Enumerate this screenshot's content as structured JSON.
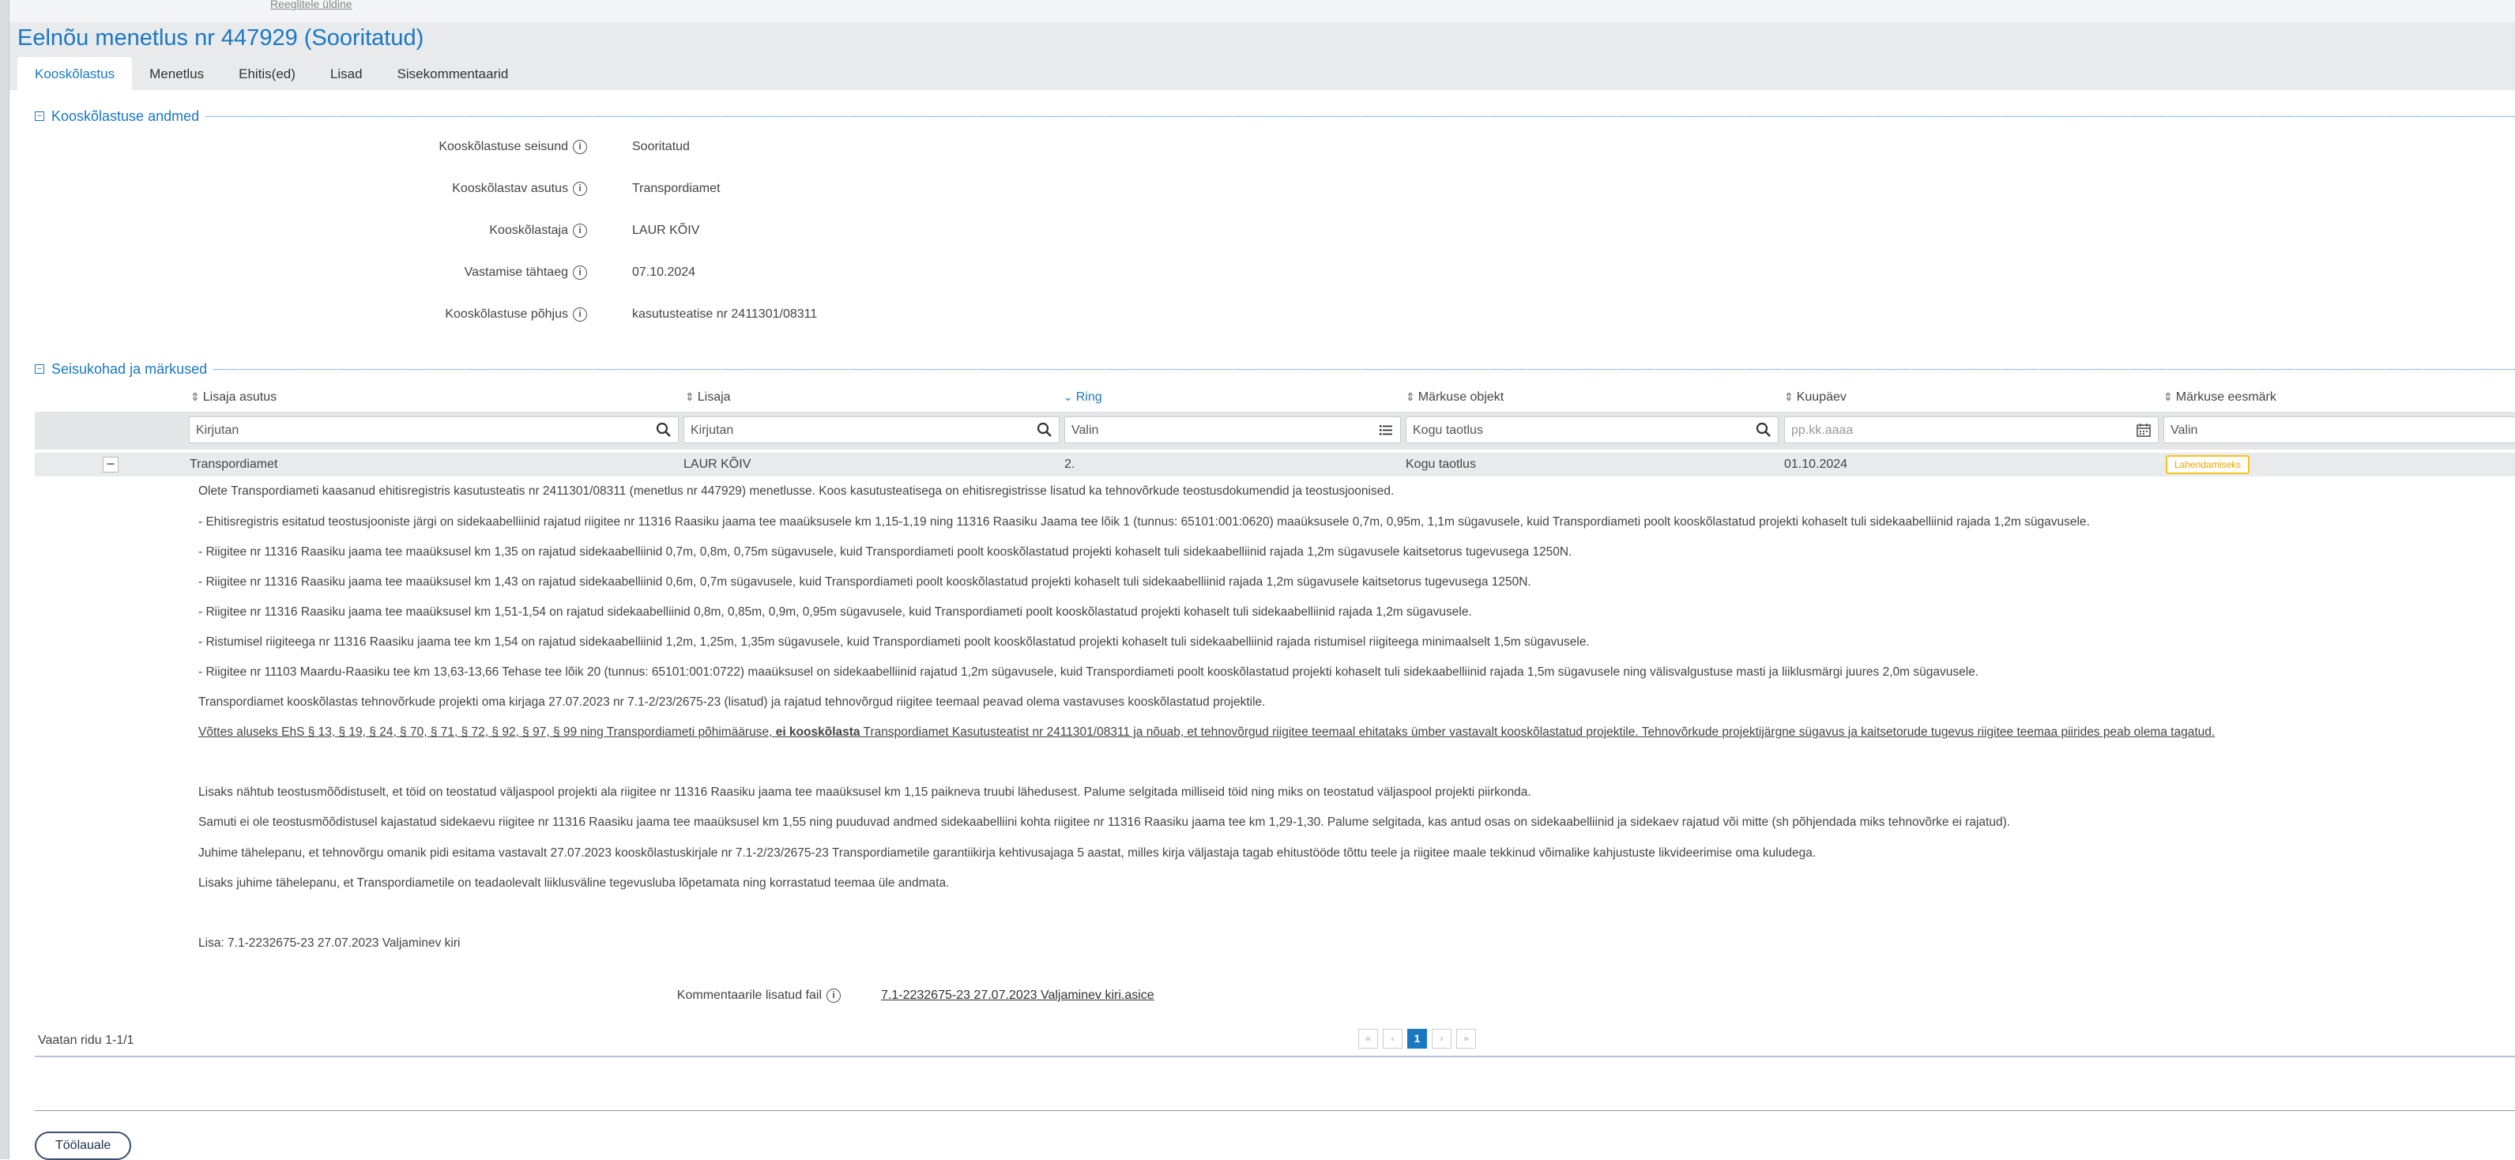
{
  "top_ghost_link": "Reeglitele üldine",
  "page_title": "Eelnõu menetlus nr 447929 (Sooritatud)",
  "tabs": [
    {
      "label": "Kooskõlastus",
      "active": true
    },
    {
      "label": "Menetlus"
    },
    {
      "label": "Ehitis(ed)"
    },
    {
      "label": "Lisad"
    },
    {
      "label": "Sisekommentaarid"
    }
  ],
  "section1": {
    "title": "Kooskõlastuse andmed",
    "toggle": "−",
    "fields": [
      {
        "label": "Kooskõlastuse seisund",
        "value": "Sooritatud"
      },
      {
        "label": "Kooskõlastav asutus",
        "value": "Transpordiamet"
      },
      {
        "label": "Kooskõlastaja",
        "value": "LAUR KÕIV"
      },
      {
        "label": "Vastamise tähtaeg",
        "value": "07.10.2024"
      },
      {
        "label": "Kooskõlastuse põhjus",
        "value": "kasutusteatise nr 2411301/08311"
      }
    ]
  },
  "section2": {
    "title": "Seisukohad ja märkused",
    "toggle": "−"
  },
  "table": {
    "columns": [
      {
        "label": "Lisaja asutus",
        "sort": "⇕"
      },
      {
        "label": "Lisaja",
        "sort": "⇕"
      },
      {
        "label": "Ring",
        "sort": "⌄",
        "sorted": true
      },
      {
        "label": "Märkuse objekt",
        "sort": "⇕"
      },
      {
        "label": "Kuupäev",
        "sort": "⇕"
      },
      {
        "label": "Märkuse eesmärk",
        "sort": "⇕"
      }
    ],
    "filters": [
      {
        "value": "Kirjutan"
      },
      {
        "value": "Kirjutan"
      },
      {
        "value": "Valin"
      },
      {
        "value": "Kogu taotlus"
      },
      {
        "placeholder": "pp.kk.aaaa"
      },
      {
        "value": "Valin"
      }
    ],
    "row": {
      "collapse": "−",
      "asutus": "Transpordiamet",
      "lisaja": "LAUR KÕIV",
      "ring": "2.",
      "objekt": "Kogu taotlus",
      "kuupaev": "01.10.2024",
      "eesmark": "Lahendamiseks"
    },
    "comment_paragraphs": [
      "Olete Transpordiameti kaasanud ehitisregistris kasutusteatis nr 2411301/08311 (menetlus nr 447929) menetlusse. Koos kasutusteatisega on ehitisregistrisse lisatud ka tehnovõrkude teostusdokumendid ja teostusjoonised.",
      "- Ehitisregistris esitatud teostusjooniste järgi on sidekaabelliinid rajatud riigitee nr 11316 Raasiku jaama tee maaüksusele km 1,15-1,19 ning 11316 Raasiku Jaama tee lõik 1 (tunnus: 65101:001:0620) maaüksusele 0,7m, 0,95m, 1,1m sügavusele, kuid Transpordiameti poolt kooskõlastatud projekti kohaselt tuli sidekaabelliinid rajada 1,2m sügavusele.",
      "- Riigitee nr 11316 Raasiku jaama tee maaüksusel km 1,35 on rajatud sidekaabelliinid 0,7m, 0,8m, 0,75m sügavusele, kuid Transpordiameti poolt kooskõlastatud projekti kohaselt tuli sidekaabelliinid rajada 1,2m sügavusele kaitsetorus tugevusega 1250N.",
      "- Riigitee nr 11316 Raasiku jaama tee maaüksusel km 1,43 on rajatud sidekaabelliinid 0,6m, 0,7m sügavusele, kuid Transpordiameti poolt kooskõlastatud projekti kohaselt tuli sidekaabelliinid rajada 1,2m sügavusele kaitsetorus tugevusega 1250N.",
      "- Riigitee nr 11316 Raasiku jaama tee maaüksusel km 1,51-1,54 on rajatud sidekaabelliinid 0,8m, 0,85m, 0,9m, 0,95m sügavusele, kuid Transpordiameti poolt kooskõlastatud projekti kohaselt tuli sidekaabelliinid rajada 1,2m sügavusele.",
      "-  Ristumisel riigiteega nr 11316 Raasiku jaama tee km 1,54 on rajatud sidekaabelliinid 1,2m, 1,25m, 1,35m sügavusele, kuid Transpordiameti poolt kooskõlastatud projekti kohaselt tuli sidekaabelliinid rajada ristumisel riigiteega minimaalselt 1,5m sügavusele.",
      "-  Riigitee nr 11103 Maardu-Raasiku tee km 13,63-13,66 Tehase tee lõik 20 (tunnus: 65101:001:0722) maaüksusel on sidekaabelliinid rajatud 1,2m sügavusele, kuid Transpordiameti poolt kooskõlastatud projekti kohaselt tuli sidekaabelliinid rajada 1,5m sügavusele ning välisvalgustuse masti ja liiklusmärgi juures 2,0m sügavusele.",
      "Transpordiamet kooskõlastas tehnovõrkude projekti oma kirjaga 27.07.2023 nr 7.1-2/23/2675-23 (lisatud) ja rajatud tehnovõrgud riigitee teemaal peavad olema vastavuses kooskõlastatud projektile."
    ],
    "underlined": {
      "before": "Võttes aluseks EhS § 13, § 19, § 24, § 70, § 71, § 72, § 92, § 97, § 99 ning Transpordiameti põhimääruse, ",
      "bold": "ei kooskõlasta",
      "after": " Transpordiamet Kasutusteatist nr 2411301/08311 ja nõuab, et tehnovõrgud riigitee teemaal ehitataks ümber vastavalt kooskõlastatud projektile. Tehnovõrkude projektijärgne sügavus ja kaitsetorude tugevus riigitee teemaa piirides peab olema tagatud."
    },
    "comment_paragraphs_2": [
      "Lisaks nähtub teostusmõõdistuselt, et töid on teostatud väljaspool projekti ala riigitee nr 11316 Raasiku jaama tee maaüksusel km 1,15 paikneva truubi lähedusest. Palume selgitada milliseid töid ning miks on teostatud väljaspool projekti piirkonda.",
      "Samuti ei ole teostusmõõdistusel kajastatud sidekaevu riigitee nr 11316 Raasiku jaama tee maaüksusel km 1,55 ning puuduvad andmed sidekaabelliini kohta riigitee nr 11316 Raasiku jaama tee km 1,29-1,30. Palume selgitada, kas antud osas on sidekaabelliinid ja sidekaev rajatud või mitte (sh põhjendada miks tehnovõrke ei rajatud).",
      "Juhime tähelepanu, et tehnovõrgu omanik pidi esitama vastavalt 27.07.2023 kooskõlastuskirjale nr 7.1-2/23/2675-23 Transpordiametile garantiikirja kehtivusajaga 5 aastat, milles kirja väljastaja tagab ehitustööde tõttu teele ja riigitee maale tekkinud võimalike kahjustuste likvideerimise oma kuludega.",
      "Lisaks juhime tähelepanu, et Transpordiametile on teadaolevalt liiklusväline tegevusluba lõpetamata ning korrastatud teemaa üle andmata."
    ],
    "attachment_note": "Lisa: 7.1-2232675-23 27.07.2023 Valjaminev kiri",
    "attached_file_label": "Kommentaarile lisatud fail",
    "attached_file_link": "7.1-2232675-23 27.07.2023 Valjaminev kiri.asice"
  },
  "pager": {
    "text": "Vaatan ridu 1-1/1",
    "first": "«",
    "prev": "‹",
    "current": "1",
    "next": "›",
    "last": "»"
  },
  "back_button": "Töölauale",
  "colors": {
    "accent": "#1a78c2",
    "badge_border": "#f5c518",
    "badge_text": "#f0a500"
  }
}
